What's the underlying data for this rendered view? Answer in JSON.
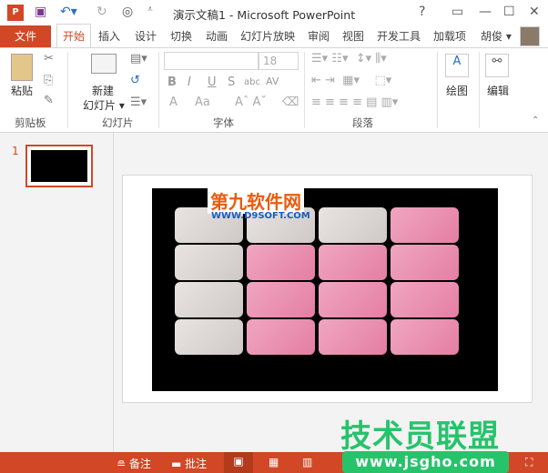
{
  "title": "演示文稿1 - Microsoft PowerPoint",
  "titlebar": {
    "help": "?",
    "restore": "▭",
    "minimize": "—",
    "maximize": "☐",
    "close": "✕"
  },
  "tabs": {
    "file": "文件",
    "home": "开始",
    "items": [
      "插入",
      "设计",
      "切换",
      "动画",
      "幻灯片放映",
      "审阅",
      "视图",
      "开发工具",
      "加载项"
    ],
    "user": "胡俊 ▾"
  },
  "ribbon": {
    "clipboard": {
      "paste": "粘贴",
      "label": "剪贴板"
    },
    "slides": {
      "new_slide": "新建",
      "new_slide2": "幻灯片 ▾",
      "label": "幻灯片"
    },
    "font": {
      "size": "18",
      "label": "字体",
      "bold": "B",
      "italic": "I",
      "underline": "U",
      "shadow": "S",
      "strike": "abc",
      "spacing": "AV",
      "fontcolor": "A",
      "case": "Aa"
    },
    "paragraph": {
      "label": "段落"
    },
    "drawing": {
      "label": "绘图"
    },
    "editing": {
      "label": "编辑"
    }
  },
  "thumbnail": {
    "number": "1"
  },
  "slide": {
    "watermark_cn": "第九软件网",
    "watermark_url": "WWW.D9SOFT.COM"
  },
  "status": {
    "notes": "≘ 备注",
    "comments": "▬ 批注"
  },
  "overlay": {
    "brand": "技术员联盟",
    "url": "www.jsgho.com"
  },
  "colors": {
    "accent": "#d24726",
    "brand_green": "#27c36b"
  }
}
